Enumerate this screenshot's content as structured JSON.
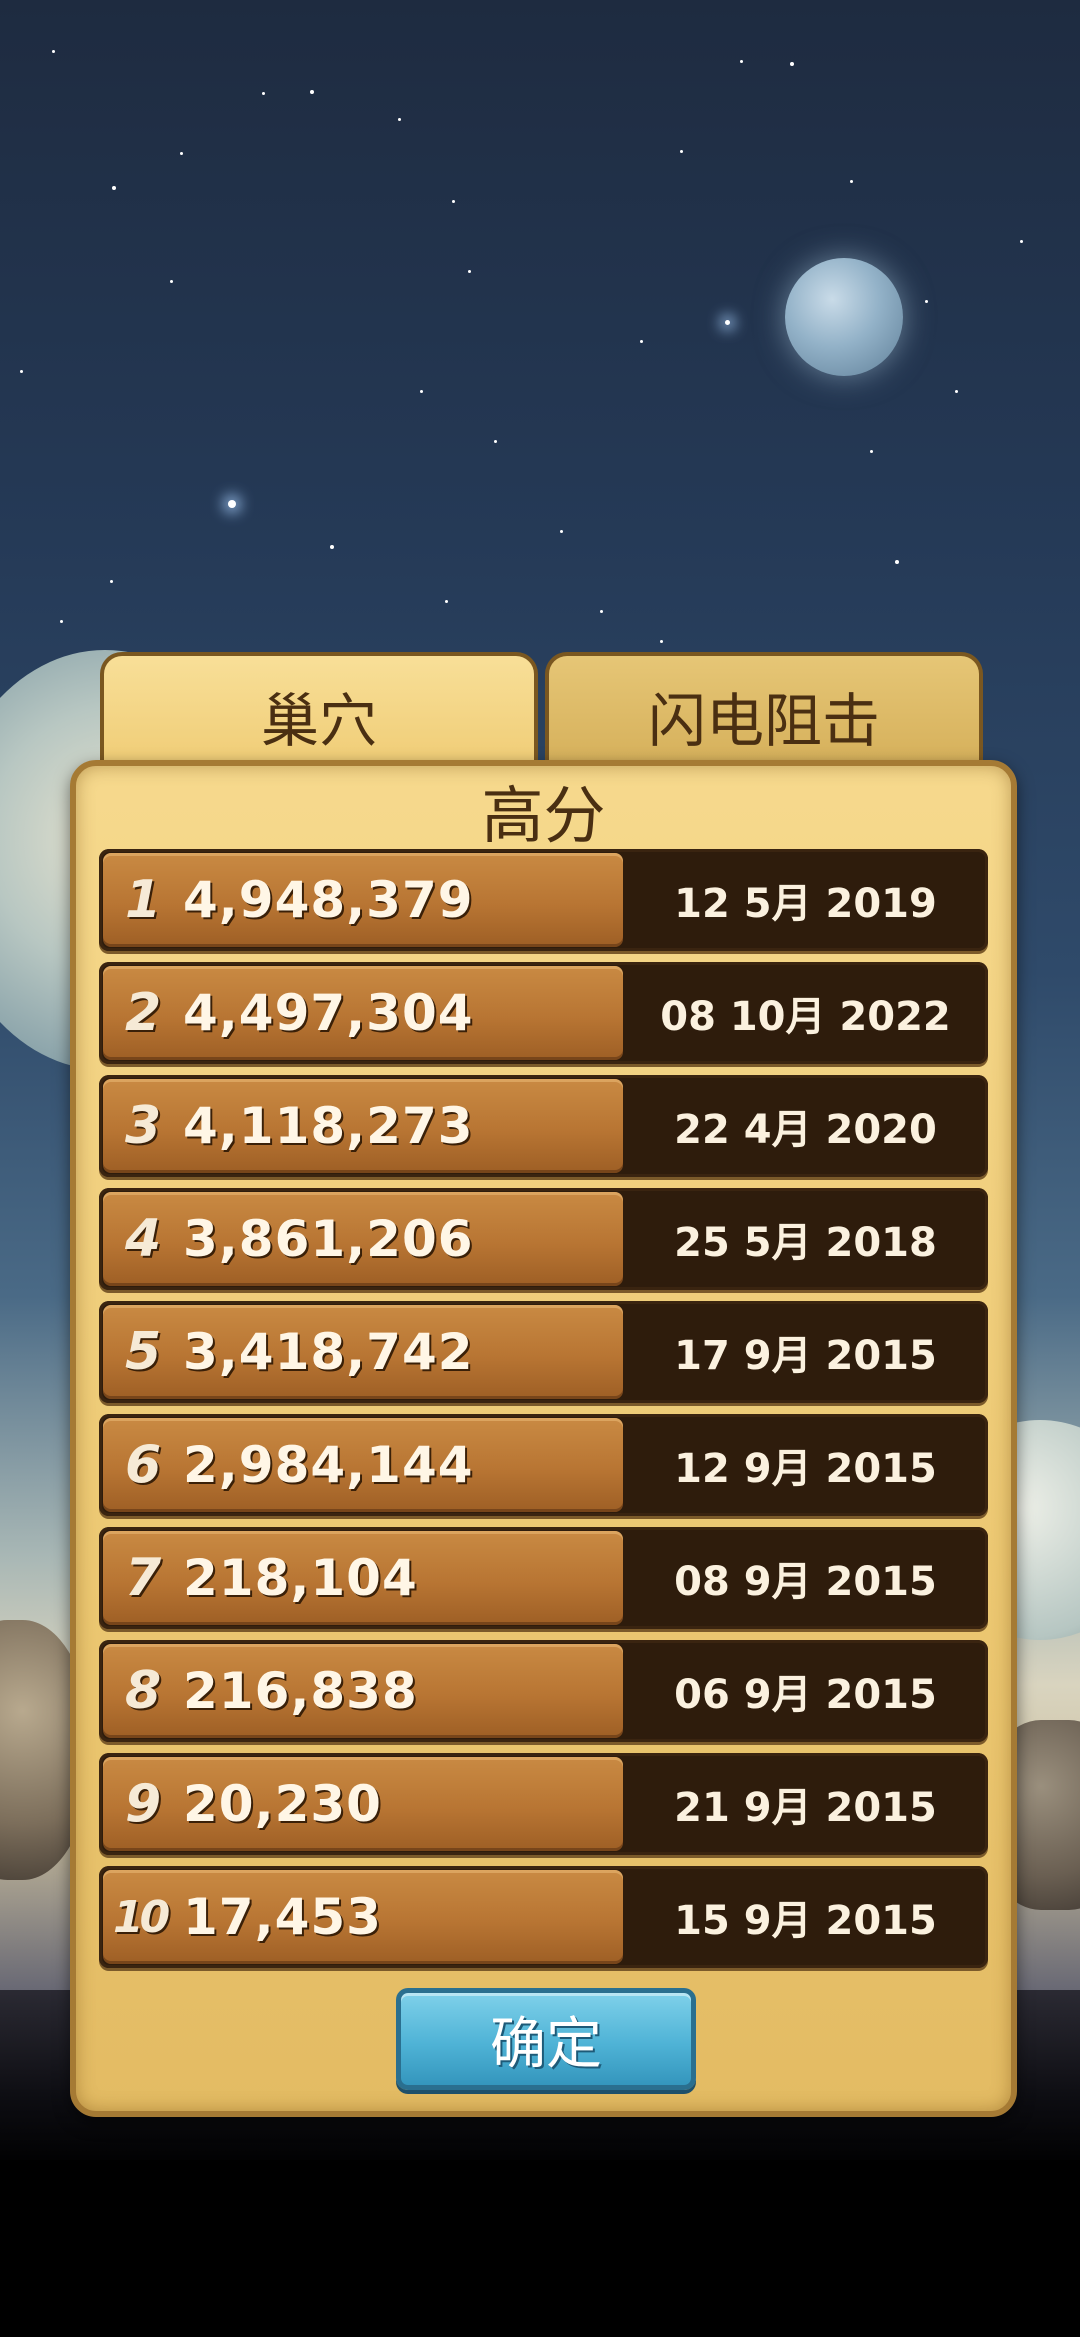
{
  "tabs": [
    {
      "label": "巢穴",
      "active": true
    },
    {
      "label": "闪电阻击",
      "active": false
    }
  ],
  "panel": {
    "title": "高分",
    "confirm_label": "确定"
  },
  "scores": [
    {
      "rank": "1",
      "score": "4,948,379",
      "date": "12 5月 2019"
    },
    {
      "rank": "2",
      "score": "4,497,304",
      "date": "08 10月 2022"
    },
    {
      "rank": "3",
      "score": "4,118,273",
      "date": "22 4月 2020"
    },
    {
      "rank": "4",
      "score": "3,861,206",
      "date": "25 5月 2018"
    },
    {
      "rank": "5",
      "score": "3,418,742",
      "date": "17 9月 2015"
    },
    {
      "rank": "6",
      "score": "2,984,144",
      "date": "12 9月 2015"
    },
    {
      "rank": "7",
      "score": "218,104",
      "date": "08 9月 2015"
    },
    {
      "rank": "8",
      "score": "216,838",
      "date": "06 9月 2015"
    },
    {
      "rank": "9",
      "score": "20,230",
      "date": "21 9月 2015"
    },
    {
      "rank": "10",
      "score": "17,453",
      "date": "15 9月 2015"
    }
  ],
  "colors": {
    "panel": "#ecc872",
    "row_dark": "#2e1c0c",
    "row_wood": "#b87533",
    "button": "#4fb3d6"
  }
}
